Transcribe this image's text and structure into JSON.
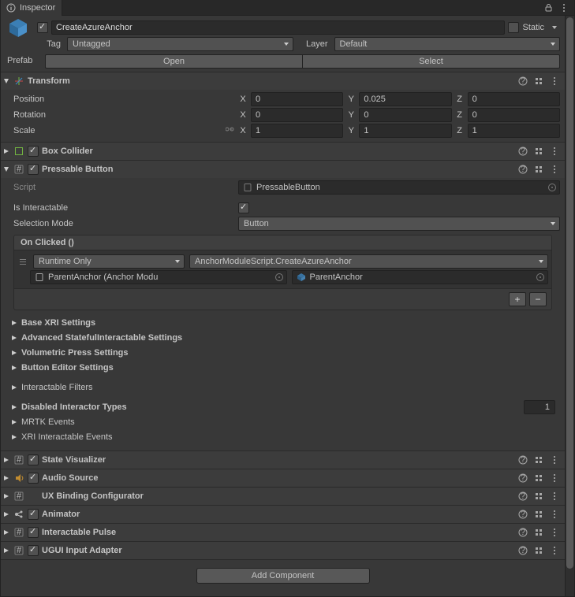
{
  "tab": {
    "title": "Inspector"
  },
  "gameobject": {
    "name": "CreateAzureAnchor",
    "enabled": true,
    "static_label": "Static",
    "static": false,
    "tag_label": "Tag",
    "tag_value": "Untagged",
    "layer_label": "Layer",
    "layer_value": "Default",
    "prefab_label": "Prefab",
    "open_btn": "Open",
    "select_btn": "Select"
  },
  "transform": {
    "title": "Transform",
    "position_label": "Position",
    "rotation_label": "Rotation",
    "scale_label": "Scale",
    "position": {
      "x": "0",
      "y": "0.025",
      "z": "0"
    },
    "rotation": {
      "x": "0",
      "y": "0",
      "z": "0"
    },
    "scale": {
      "x": "1",
      "y": "1",
      "z": "1"
    }
  },
  "boxcollider": {
    "title": "Box Collider",
    "enabled": true
  },
  "pressable": {
    "title": "Pressable Button",
    "enabled": true,
    "script_label": "Script",
    "script_value": "PressableButton",
    "is_interactable_label": "Is Interactable",
    "is_interactable": true,
    "selection_mode_label": "Selection Mode",
    "selection_mode_value": "Button",
    "event_title": "On Clicked ()",
    "runtime": "Runtime Only",
    "method": "AnchorModuleScript.CreateAzureAnchor",
    "target_obj": "ParentAnchor (Anchor Modu",
    "arg_obj": "ParentAnchor",
    "sections": {
      "base_xri": "Base XRI Settings",
      "adv_stateful": "Advanced StatefulInteractable Settings",
      "vol_press": "Volumetric Press Settings",
      "btn_editor": "Button Editor Settings",
      "int_filters": "Interactable Filters",
      "disabled_types": "Disabled Interactor Types",
      "disabled_count": "1",
      "mrtk_events": "MRTK Events",
      "xri_events": "XRI Interactable Events"
    }
  },
  "components": {
    "state_visualizer": {
      "title": "State Visualizer",
      "enabled": true
    },
    "audio_source": {
      "title": "Audio Source",
      "enabled": true
    },
    "ux_binding": {
      "title": "UX Binding Configurator"
    },
    "animator": {
      "title": "Animator",
      "enabled": true
    },
    "interactable_pulse": {
      "title": "Interactable Pulse",
      "enabled": true
    },
    "ugui_input": {
      "title": "UGUI Input Adapter",
      "enabled": true
    }
  },
  "add_component": "Add Component"
}
